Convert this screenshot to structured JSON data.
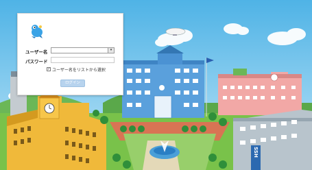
{
  "login_form": {
    "username_label": "ユーザー名",
    "password_label": "パスワード",
    "username_value": "",
    "password_value": "",
    "remember_label": "ユーザー名をリストから選択",
    "remember_checked": true,
    "login_button_label": "ログイン",
    "dropdown_arrow": "▾",
    "check_mark": "✓"
  },
  "background": {
    "sign_text": "SSH"
  },
  "icons": [
    "mascot-icon",
    "clock-icon",
    "flag-icon",
    "blimp-icon"
  ],
  "colors": {
    "sky": "#7fc6ea",
    "grass": "#79c24a",
    "button": "#b7d3ee"
  }
}
